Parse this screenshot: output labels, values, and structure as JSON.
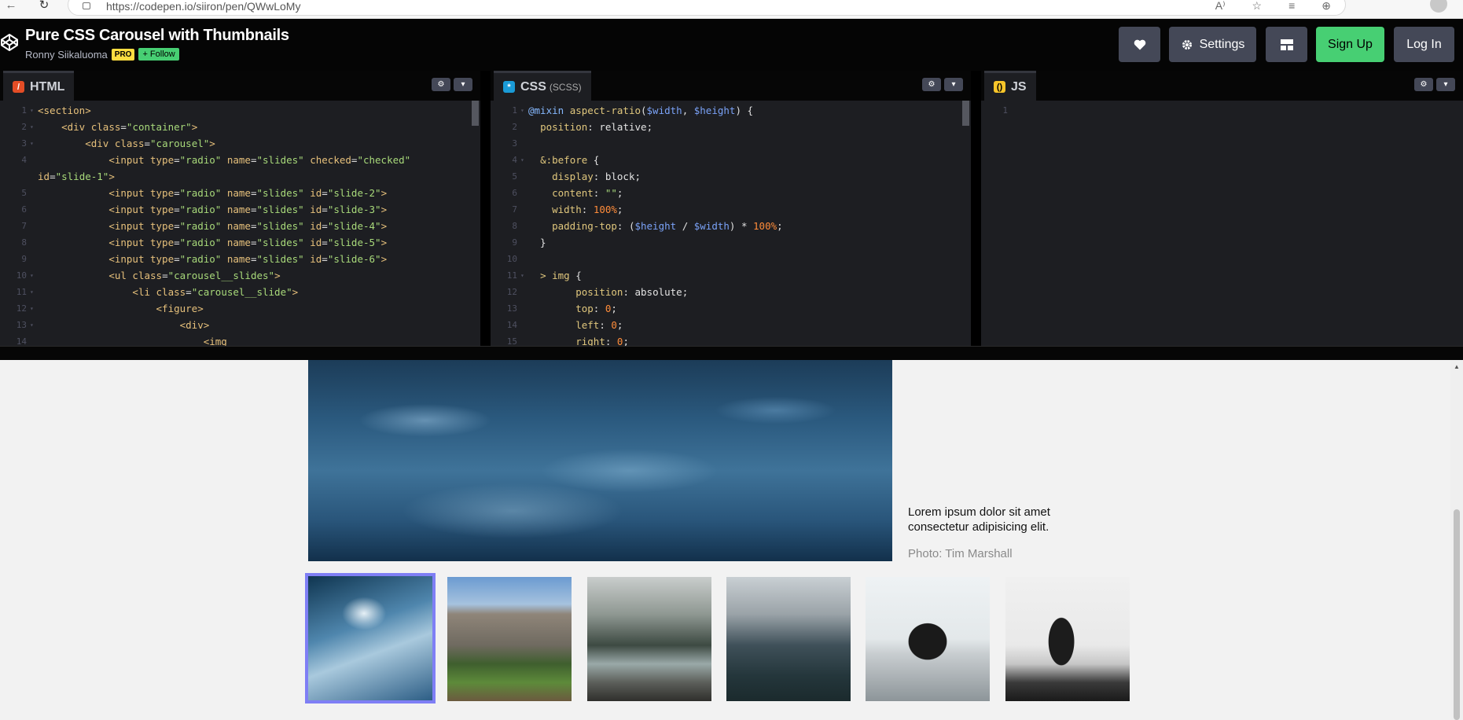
{
  "browser": {
    "url": "https://codepen.io/siiron/pen/QWwLoMy",
    "back_icon": "←",
    "reload_icon": "↻",
    "tool_icons": [
      "A⁾",
      "☆",
      "≡",
      "⊕"
    ]
  },
  "header": {
    "pen_title": "Pure CSS Carousel with Thumbnails",
    "author": "Ronny Siikaluoma",
    "pro_badge": "PRO",
    "follow_label": "+ Follow",
    "settings_label": "Settings",
    "signup_label": "Sign Up",
    "login_label": "Log In"
  },
  "editors": {
    "html": {
      "title": "HTML",
      "lines": [
        {
          "n": "1",
          "fold": "▾",
          "segs": [
            [
              "t-tag",
              "<section>"
            ]
          ]
        },
        {
          "n": "2",
          "fold": "▾",
          "segs": [
            [
              "t-plain",
              "    "
            ],
            [
              "t-tag",
              "<div "
            ],
            [
              "t-attr",
              "class"
            ],
            [
              "t-plain",
              "="
            ],
            [
              "t-str",
              "\"container\""
            ],
            [
              "t-tag",
              ">"
            ]
          ]
        },
        {
          "n": "3",
          "fold": "▾",
          "segs": [
            [
              "t-plain",
              "        "
            ],
            [
              "t-tag",
              "<div "
            ],
            [
              "t-attr",
              "class"
            ],
            [
              "t-plain",
              "="
            ],
            [
              "t-str",
              "\"carousel\""
            ],
            [
              "t-tag",
              ">"
            ]
          ]
        },
        {
          "n": "4",
          "fold": "",
          "segs": [
            [
              "t-plain",
              "            "
            ],
            [
              "t-tag",
              "<input "
            ],
            [
              "t-attr",
              "type"
            ],
            [
              "t-plain",
              "="
            ],
            [
              "t-str",
              "\"radio\" "
            ],
            [
              "t-attr",
              "name"
            ],
            [
              "t-plain",
              "="
            ],
            [
              "t-str",
              "\"slides\" "
            ],
            [
              "t-attr",
              "checked"
            ],
            [
              "t-plain",
              "="
            ],
            [
              "t-str",
              "\"checked\""
            ]
          ]
        },
        {
          "n": "",
          "fold": "",
          "segs": [
            [
              "t-attr",
              "id"
            ],
            [
              "t-plain",
              "="
            ],
            [
              "t-str",
              "\"slide-1\""
            ],
            [
              "t-tag",
              ">"
            ]
          ]
        },
        {
          "n": "5",
          "fold": "",
          "segs": [
            [
              "t-plain",
              "            "
            ],
            [
              "t-tag",
              "<input "
            ],
            [
              "t-attr",
              "type"
            ],
            [
              "t-plain",
              "="
            ],
            [
              "t-str",
              "\"radio\" "
            ],
            [
              "t-attr",
              "name"
            ],
            [
              "t-plain",
              "="
            ],
            [
              "t-str",
              "\"slides\" "
            ],
            [
              "t-attr",
              "id"
            ],
            [
              "t-plain",
              "="
            ],
            [
              "t-str",
              "\"slide-2\""
            ],
            [
              "t-tag",
              ">"
            ]
          ]
        },
        {
          "n": "6",
          "fold": "",
          "segs": [
            [
              "t-plain",
              "            "
            ],
            [
              "t-tag",
              "<input "
            ],
            [
              "t-attr",
              "type"
            ],
            [
              "t-plain",
              "="
            ],
            [
              "t-str",
              "\"radio\" "
            ],
            [
              "t-attr",
              "name"
            ],
            [
              "t-plain",
              "="
            ],
            [
              "t-str",
              "\"slides\" "
            ],
            [
              "t-attr",
              "id"
            ],
            [
              "t-plain",
              "="
            ],
            [
              "t-str",
              "\"slide-3\""
            ],
            [
              "t-tag",
              ">"
            ]
          ]
        },
        {
          "n": "7",
          "fold": "",
          "segs": [
            [
              "t-plain",
              "            "
            ],
            [
              "t-tag",
              "<input "
            ],
            [
              "t-attr",
              "type"
            ],
            [
              "t-plain",
              "="
            ],
            [
              "t-str",
              "\"radio\" "
            ],
            [
              "t-attr",
              "name"
            ],
            [
              "t-plain",
              "="
            ],
            [
              "t-str",
              "\"slides\" "
            ],
            [
              "t-attr",
              "id"
            ],
            [
              "t-plain",
              "="
            ],
            [
              "t-str",
              "\"slide-4\""
            ],
            [
              "t-tag",
              ">"
            ]
          ]
        },
        {
          "n": "8",
          "fold": "",
          "segs": [
            [
              "t-plain",
              "            "
            ],
            [
              "t-tag",
              "<input "
            ],
            [
              "t-attr",
              "type"
            ],
            [
              "t-plain",
              "="
            ],
            [
              "t-str",
              "\"radio\" "
            ],
            [
              "t-attr",
              "name"
            ],
            [
              "t-plain",
              "="
            ],
            [
              "t-str",
              "\"slides\" "
            ],
            [
              "t-attr",
              "id"
            ],
            [
              "t-plain",
              "="
            ],
            [
              "t-str",
              "\"slide-5\""
            ],
            [
              "t-tag",
              ">"
            ]
          ]
        },
        {
          "n": "9",
          "fold": "",
          "segs": [
            [
              "t-plain",
              "            "
            ],
            [
              "t-tag",
              "<input "
            ],
            [
              "t-attr",
              "type"
            ],
            [
              "t-plain",
              "="
            ],
            [
              "t-str",
              "\"radio\" "
            ],
            [
              "t-attr",
              "name"
            ],
            [
              "t-plain",
              "="
            ],
            [
              "t-str",
              "\"slides\" "
            ],
            [
              "t-attr",
              "id"
            ],
            [
              "t-plain",
              "="
            ],
            [
              "t-str",
              "\"slide-6\""
            ],
            [
              "t-tag",
              ">"
            ]
          ]
        },
        {
          "n": "10",
          "fold": "▾",
          "segs": [
            [
              "t-plain",
              "            "
            ],
            [
              "t-tag",
              "<ul "
            ],
            [
              "t-attr",
              "class"
            ],
            [
              "t-plain",
              "="
            ],
            [
              "t-str",
              "\"carousel__slides\""
            ],
            [
              "t-tag",
              ">"
            ]
          ]
        },
        {
          "n": "11",
          "fold": "▾",
          "segs": [
            [
              "t-plain",
              "                "
            ],
            [
              "t-tag",
              "<li "
            ],
            [
              "t-attr",
              "class"
            ],
            [
              "t-plain",
              "="
            ],
            [
              "t-str",
              "\"carousel__slide\""
            ],
            [
              "t-tag",
              ">"
            ]
          ]
        },
        {
          "n": "12",
          "fold": "▾",
          "segs": [
            [
              "t-plain",
              "                    "
            ],
            [
              "t-tag",
              "<figure>"
            ]
          ]
        },
        {
          "n": "13",
          "fold": "▾",
          "segs": [
            [
              "t-plain",
              "                        "
            ],
            [
              "t-tag",
              "<div>"
            ]
          ]
        },
        {
          "n": "14",
          "fold": "",
          "segs": [
            [
              "t-plain",
              "                            "
            ],
            [
              "t-tag",
              "<img"
            ]
          ]
        }
      ]
    },
    "css": {
      "title": "CSS",
      "subtitle": "(SCSS)",
      "lines": [
        {
          "n": "1",
          "fold": "▾",
          "segs": [
            [
              "t-kw",
              "@mixin "
            ],
            [
              "t-prop",
              "aspect-ratio"
            ],
            [
              "t-plain",
              "("
            ],
            [
              "t-var",
              "$width"
            ],
            [
              "t-plain",
              ", "
            ],
            [
              "t-var",
              "$height"
            ],
            [
              "t-plain",
              ") {"
            ]
          ]
        },
        {
          "n": "2",
          "fold": "",
          "segs": [
            [
              "t-plain",
              "  "
            ],
            [
              "t-prop",
              "position"
            ],
            [
              "t-plain",
              ": "
            ],
            [
              "t-val",
              "relative"
            ],
            [
              "t-plain",
              ";"
            ]
          ]
        },
        {
          "n": "3",
          "fold": "",
          "segs": [
            [
              "t-plain",
              ""
            ]
          ]
        },
        {
          "n": "4",
          "fold": "▾",
          "segs": [
            [
              "t-plain",
              "  "
            ],
            [
              "t-prop",
              "&:before"
            ],
            [
              "t-plain",
              " {"
            ]
          ]
        },
        {
          "n": "5",
          "fold": "",
          "segs": [
            [
              "t-plain",
              "    "
            ],
            [
              "t-prop",
              "display"
            ],
            [
              "t-plain",
              ": "
            ],
            [
              "t-val",
              "block"
            ],
            [
              "t-plain",
              ";"
            ]
          ]
        },
        {
          "n": "6",
          "fold": "",
          "segs": [
            [
              "t-plain",
              "    "
            ],
            [
              "t-prop",
              "content"
            ],
            [
              "t-plain",
              ": "
            ],
            [
              "t-str",
              "\"\""
            ],
            [
              "t-plain",
              ";"
            ]
          ]
        },
        {
          "n": "7",
          "fold": "",
          "segs": [
            [
              "t-plain",
              "    "
            ],
            [
              "t-prop",
              "width"
            ],
            [
              "t-plain",
              ": "
            ],
            [
              "t-num",
              "100%"
            ],
            [
              "t-plain",
              ";"
            ]
          ]
        },
        {
          "n": "8",
          "fold": "",
          "segs": [
            [
              "t-plain",
              "    "
            ],
            [
              "t-prop",
              "padding-top"
            ],
            [
              "t-plain",
              ": ("
            ],
            [
              "t-var",
              "$height"
            ],
            [
              "t-plain",
              " / "
            ],
            [
              "t-var",
              "$width"
            ],
            [
              "t-plain",
              ") * "
            ],
            [
              "t-num",
              "100%"
            ],
            [
              "t-plain",
              ";"
            ]
          ]
        },
        {
          "n": "9",
          "fold": "",
          "segs": [
            [
              "t-plain",
              "  }"
            ]
          ]
        },
        {
          "n": "10",
          "fold": "",
          "segs": [
            [
              "t-plain",
              ""
            ]
          ]
        },
        {
          "n": "11",
          "fold": "▾",
          "segs": [
            [
              "t-plain",
              "  "
            ],
            [
              "t-prop",
              "> img"
            ],
            [
              "t-plain",
              " {"
            ]
          ]
        },
        {
          "n": "12",
          "fold": "",
          "segs": [
            [
              "t-plain",
              "        "
            ],
            [
              "t-prop",
              "position"
            ],
            [
              "t-plain",
              ": "
            ],
            [
              "t-val",
              "absolute"
            ],
            [
              "t-plain",
              ";"
            ]
          ]
        },
        {
          "n": "13",
          "fold": "",
          "segs": [
            [
              "t-plain",
              "        "
            ],
            [
              "t-prop",
              "top"
            ],
            [
              "t-plain",
              ": "
            ],
            [
              "t-num",
              "0"
            ],
            [
              "t-plain",
              ";"
            ]
          ]
        },
        {
          "n": "14",
          "fold": "",
          "segs": [
            [
              "t-plain",
              "        "
            ],
            [
              "t-prop",
              "left"
            ],
            [
              "t-plain",
              ": "
            ],
            [
              "t-num",
              "0"
            ],
            [
              "t-plain",
              ";"
            ]
          ]
        },
        {
          "n": "15",
          "fold": "",
          "segs": [
            [
              "t-plain",
              "        "
            ],
            [
              "t-prop",
              "right"
            ],
            [
              "t-plain",
              ": "
            ],
            [
              "t-num",
              "0"
            ],
            [
              "t-plain",
              ";"
            ]
          ]
        }
      ]
    },
    "js": {
      "title": "JS",
      "lines": [
        {
          "n": "1",
          "fold": "",
          "segs": [
            [
              "t-plain",
              ""
            ]
          ]
        }
      ]
    }
  },
  "preview": {
    "caption": "Lorem ipsum dolor sit amet consectetur adipisicing elit.",
    "credit": "Photo: Tim Marshall",
    "selected_thumbnail": 1,
    "thumbnail_count": 6
  },
  "colors": {
    "accent_selected": "#7f7ff5",
    "signup_green": "#47cf73",
    "pro_yellow": "#ffdd40",
    "html_icon": "#e44d26",
    "css_icon": "#1a9bd7",
    "js_icon": "#f7c52a"
  }
}
